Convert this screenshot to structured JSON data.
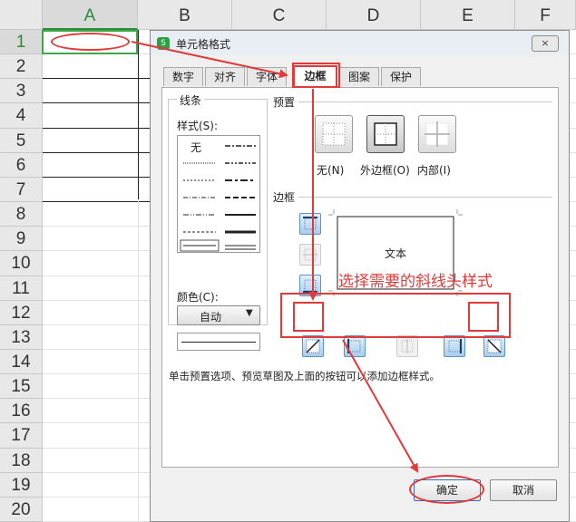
{
  "sheet": {
    "columns": [
      "A",
      "B",
      "C",
      "D",
      "E",
      "F"
    ],
    "rows": [
      "1",
      "2",
      "3",
      "4",
      "5",
      "6",
      "7",
      "8",
      "9",
      "10",
      "11",
      "12",
      "13",
      "14",
      "15",
      "16",
      "17",
      "18",
      "19",
      "20"
    ]
  },
  "dialog": {
    "title": "单元格格式",
    "close_icon": "×",
    "tabs": [
      "数字",
      "对齐",
      "字体",
      "边框",
      "图案",
      "保护"
    ],
    "active_tab": "边框",
    "line_group": {
      "title": "线条",
      "style_label": "样式(S):",
      "none_label": "无",
      "color_label": "颜色(C):",
      "color_value": "自动"
    },
    "preset_group": {
      "title": "预置",
      "none": "无(N)",
      "outline": "外边框(O)",
      "inside": "内部(I)"
    },
    "border_group": {
      "title": "边框",
      "preview_text": "文本"
    },
    "hint": "单击预置选项、预览草图及上面的按钮可以添加边框样式。",
    "ok": "确定",
    "cancel": "取消"
  },
  "annotation": {
    "text": "选择需要的斜线头样式",
    "color": "#e03a3a"
  }
}
